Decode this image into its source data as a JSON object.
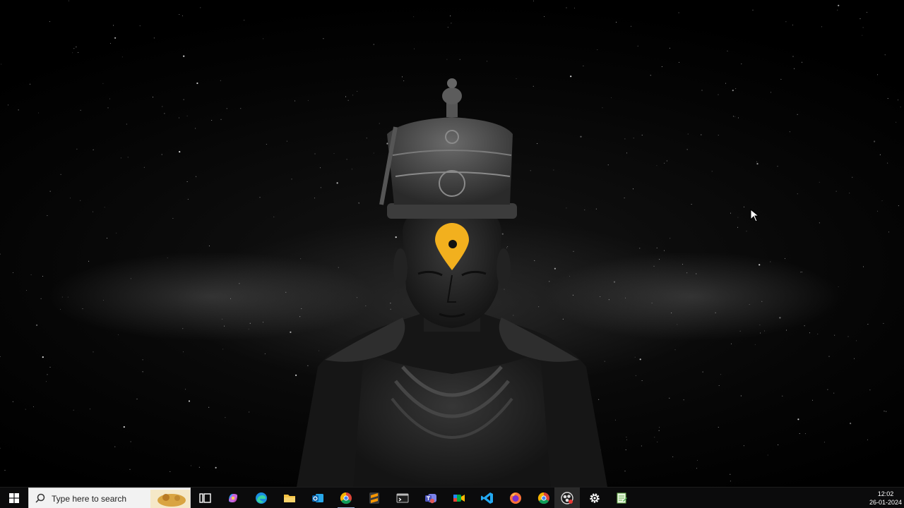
{
  "desktop": {
    "wallpaper": "dark starry galaxy with black deity idol and golden tilak",
    "accent_tilak_color": "#f2b01e"
  },
  "taskbar": {
    "search_placeholder": "Type here to search",
    "apps": [
      {
        "name": "task-view-icon"
      },
      {
        "name": "copilot-icon"
      },
      {
        "name": "edge-icon"
      },
      {
        "name": "file-explorer-icon"
      },
      {
        "name": "outlook-icon"
      },
      {
        "name": "chrome-icon"
      },
      {
        "name": "sublime-text-icon"
      },
      {
        "name": "terminal-icon"
      },
      {
        "name": "teams-icon"
      },
      {
        "name": "meet-icon"
      },
      {
        "name": "vscode-icon"
      },
      {
        "name": "firefox-icon"
      },
      {
        "name": "chrome-icon"
      },
      {
        "name": "obs-icon"
      },
      {
        "name": "settings-gear-icon"
      },
      {
        "name": "notepad-icon"
      }
    ],
    "clock": {
      "time": "12:02",
      "date": "26-01-2024"
    }
  }
}
